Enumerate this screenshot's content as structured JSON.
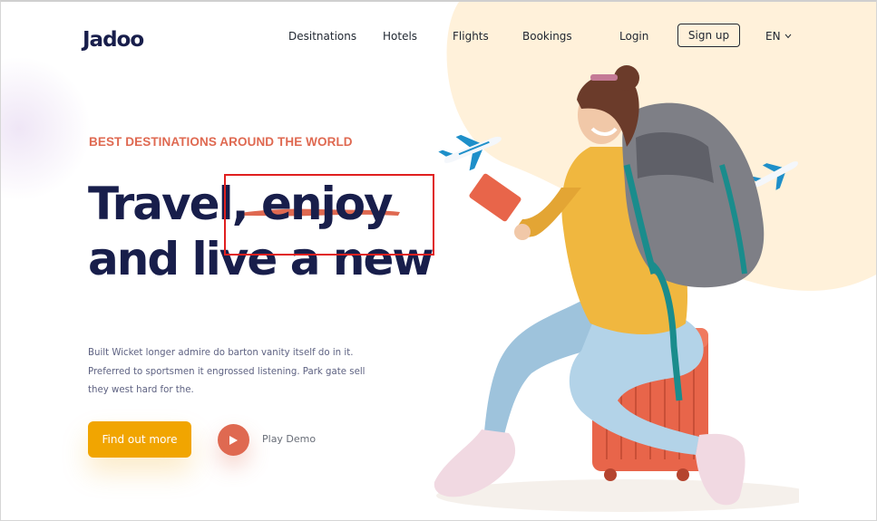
{
  "brand": {
    "logo": "Jadoo"
  },
  "nav": {
    "items": [
      {
        "label": "Desitnations"
      },
      {
        "label": "Hotels"
      },
      {
        "label": "Flights"
      },
      {
        "label": "Bookings"
      }
    ],
    "login": "Login",
    "signup": "Sign up",
    "language": "EN"
  },
  "hero": {
    "eyebrow": "BEST DESTINATIONS AROUND THE WORLD",
    "headline_line1": "Travel, enjoy",
    "headline_line2": "and live a new",
    "description": "Built Wicket longer admire do barton vanity itself do in it. Preferred to sportsmen it engrossed listening. Park gate sell they west hard for the.",
    "cta": "Find out more",
    "play_label": "Play Demo"
  },
  "colors": {
    "accent": "#df6951",
    "cta": "#f1a501",
    "heading": "#181e4b",
    "body_text": "#5e6282",
    "peach_bg": "#fff1da",
    "annotation": "#e02020"
  },
  "icons": [
    "chevron-down-icon",
    "play-icon",
    "airplane-icon"
  ]
}
